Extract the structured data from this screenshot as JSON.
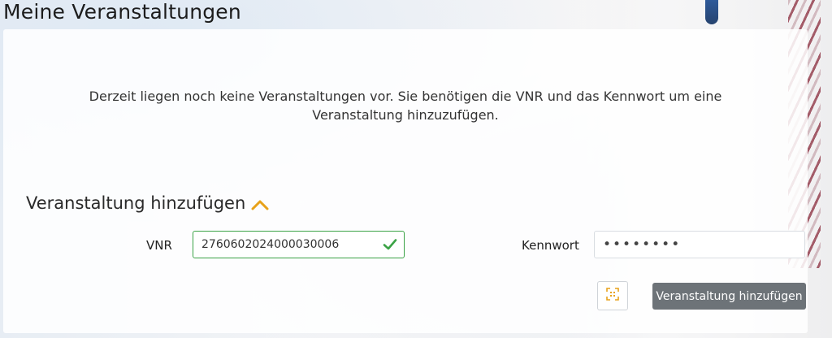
{
  "page": {
    "title": "Meine Veranstaltungen"
  },
  "info_text": "Derzeit liegen noch keine Veranstaltungen vor. Sie benötigen die VNR und das Kennwort um eine Veranstaltung hinzuzufügen.",
  "add_section": {
    "title": "Veranstaltung hinzufügen",
    "toggle_icon": "chevron-up-icon",
    "vnr_label": "VNR",
    "vnr_value": "2760602024000030006",
    "vnr_status_icon": "check-icon",
    "password_label": "Kennwort",
    "password_value": "••••••••",
    "qr_icon": "qr-scan-icon",
    "submit_label": "Veranstaltung hinzufügen"
  },
  "colors": {
    "accent_orange": "#e8a21a",
    "valid_green": "#3ba346",
    "button_gray": "#6d7378"
  }
}
